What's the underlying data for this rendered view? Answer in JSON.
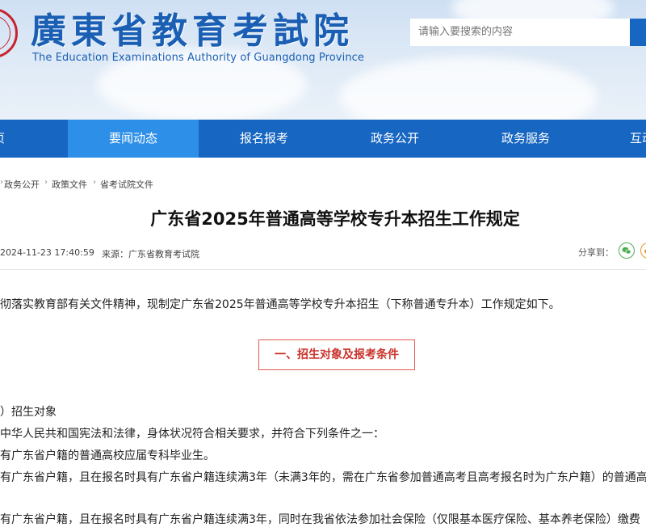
{
  "header": {
    "logo_cn": "廣東省教育考試院",
    "logo_en": "The Education Examinations Authority of Guangdong Province",
    "search_placeholder": "请输入要搜索的内容"
  },
  "nav": {
    "items": [
      {
        "label": "首页"
      },
      {
        "label": "要闻动态"
      },
      {
        "label": "报名报考"
      },
      {
        "label": "政务公开"
      },
      {
        "label": "政务服务"
      },
      {
        "label": "互动"
      }
    ],
    "active_index": 1
  },
  "breadcrumb": [
    "政务公开",
    "政策文件",
    "省考试院文件"
  ],
  "article": {
    "title": "广东省2025年普通高等学校专升本招生工作规定",
    "date": "2024-11-23 17:40:59",
    "source": "来源：广东省教育考试院",
    "share_label": "分享到：",
    "intro": "彻落实教育部有关文件精神，现制定广东省2025年普通高等学校专升本招生（下称普通专升本）工作规定如下。",
    "section_title": "一、招生对象及报考条件",
    "sub_heading": "）招生对象",
    "lines": [
      "中华人民共和国宪法和法律，身体状况符合相关要求，并符合下列条件之一：",
      "有广东省户籍的普通高校应届专科毕业生。",
      "有广东省户籍，且在报名时具有广东省户籍连续满3年（未满3年的，需在广东省参加普通高考且高考报名时为广东户籍）的普通高校",
      "有广东省户籍，且在报名时具有广东省户籍连续满3年，同时在我省依法参加社会保险（仅限基本医疗保险、基本养老保险）缴费"
    ]
  },
  "colors": {
    "nav_bg": "#1666c2",
    "nav_active": "#2e8fe8",
    "logo": "#1a5fb4",
    "section": "#c9332b"
  }
}
